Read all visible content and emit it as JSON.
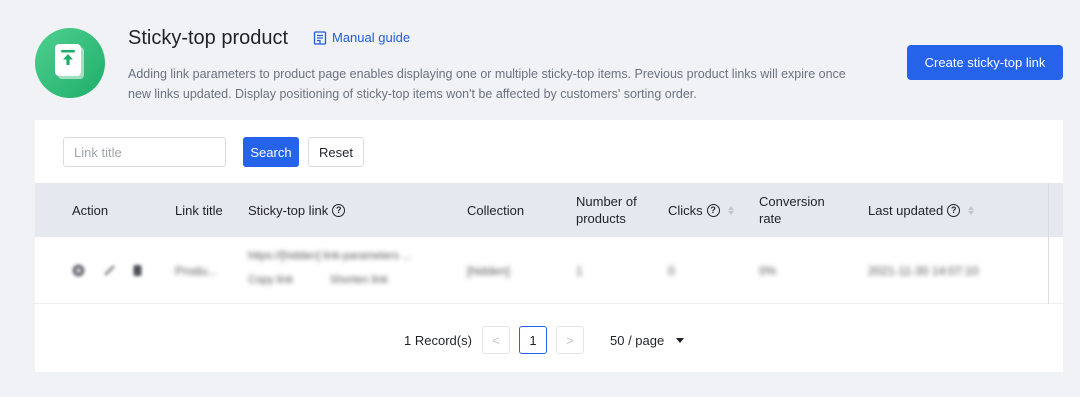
{
  "header": {
    "title": "Sticky-top product",
    "guide_label": "Manual guide",
    "description": "Adding link parameters to product page enables displaying one or multiple sticky-top items. Previous product links will expire once new links updated. Display positioning of sticky-top items won't be affected by customers' sorting order.",
    "create_button": "Create sticky-top link",
    "app_icon": "pin-to-top-icon"
  },
  "filters": {
    "search_placeholder": "Link title",
    "search_button": "Search",
    "reset_button": "Reset"
  },
  "table": {
    "columns": [
      "Action",
      "Link title",
      "Sticky-top link",
      "Collection",
      "Number of products",
      "Clicks",
      "Conversion rate",
      "Last updated"
    ],
    "col_action": "Action",
    "col_link_title": "Link title",
    "col_sticky_link": "Sticky-top link",
    "col_collection": "Collection",
    "col_products_l1": "Number of",
    "col_products_l2": "products",
    "col_clicks": "Clicks",
    "col_conversion_l1": "Conversion",
    "col_conversion_l2": "rate",
    "col_last_updated": "Last updated",
    "help_glyph": "?",
    "rows": [
      {
        "link_title": "Produ...",
        "sticky_link": "https://[hidden] link-parameters ...",
        "link_tags": [
          "Copy link",
          "Shorten link"
        ],
        "collection": "[hidden]",
        "products": "1",
        "clicks": "0",
        "conversion": "0%",
        "last_updated": "2021-11-30 14:07:10"
      }
    ]
  },
  "pagination": {
    "total": "1 Record(s)",
    "prev": "<",
    "current": "1",
    "next": ">",
    "page_size": "50 / page"
  },
  "colors": {
    "primary": "#2563eb",
    "icon_green": "#1fae6a",
    "header_bg": "#e5e8ee",
    "page_bg": "#f0f2f5"
  }
}
